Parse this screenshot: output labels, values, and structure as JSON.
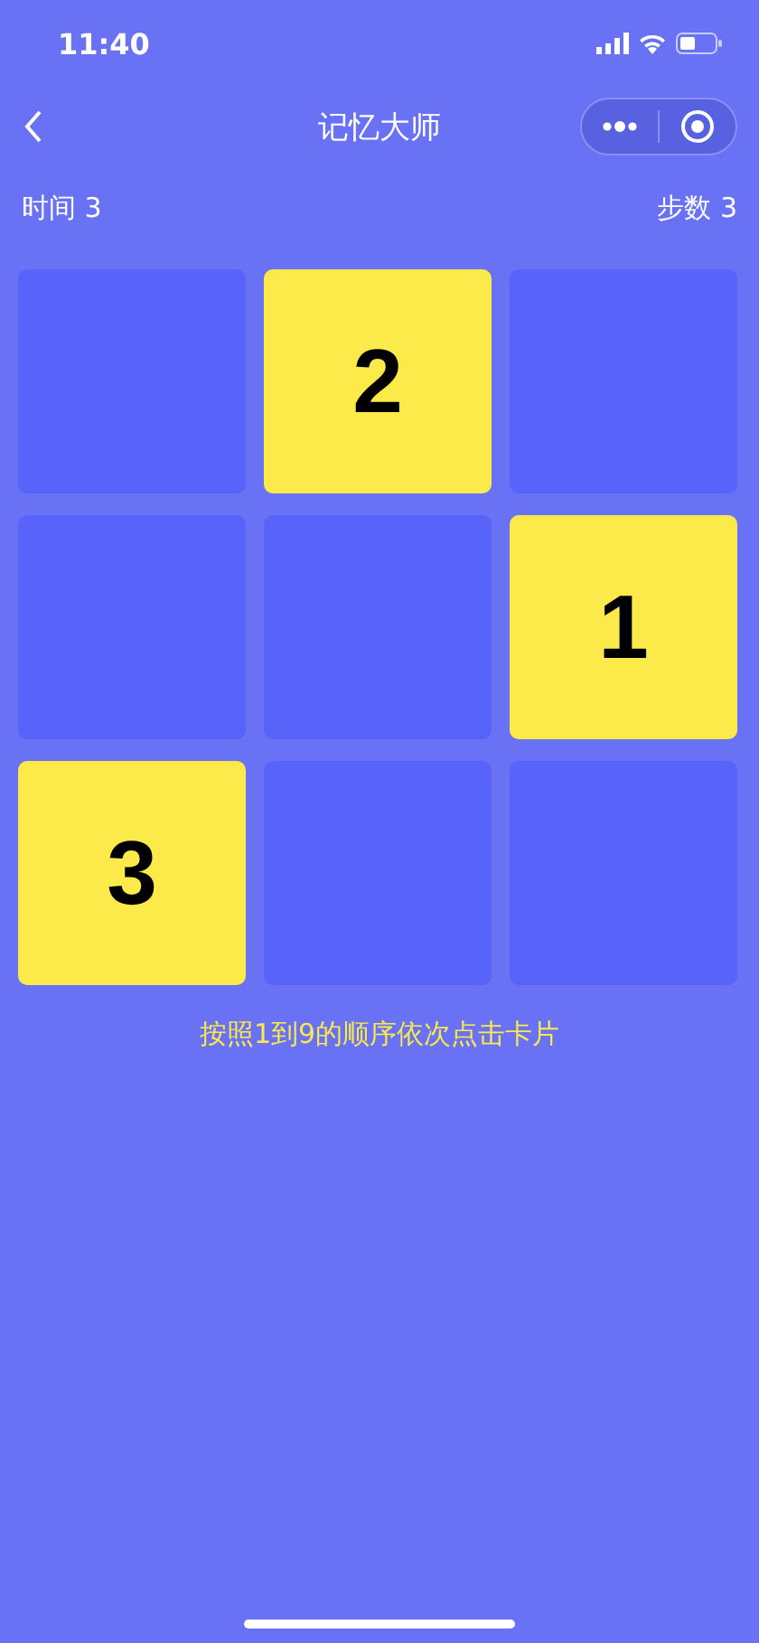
{
  "status_bar": {
    "time": "11:40"
  },
  "nav": {
    "title": "记忆大师"
  },
  "stats": {
    "time": "时间 3",
    "steps": "步数 3"
  },
  "cards": [
    {
      "revealed": false
    },
    {
      "revealed": true,
      "label": "2"
    },
    {
      "revealed": false
    },
    {
      "revealed": false
    },
    {
      "revealed": false
    },
    {
      "revealed": true,
      "label": "1"
    },
    {
      "revealed": true,
      "label": "3"
    },
    {
      "revealed": false
    },
    {
      "revealed": false
    }
  ],
  "hint": "按照1到9的顺序依次点击卡片"
}
